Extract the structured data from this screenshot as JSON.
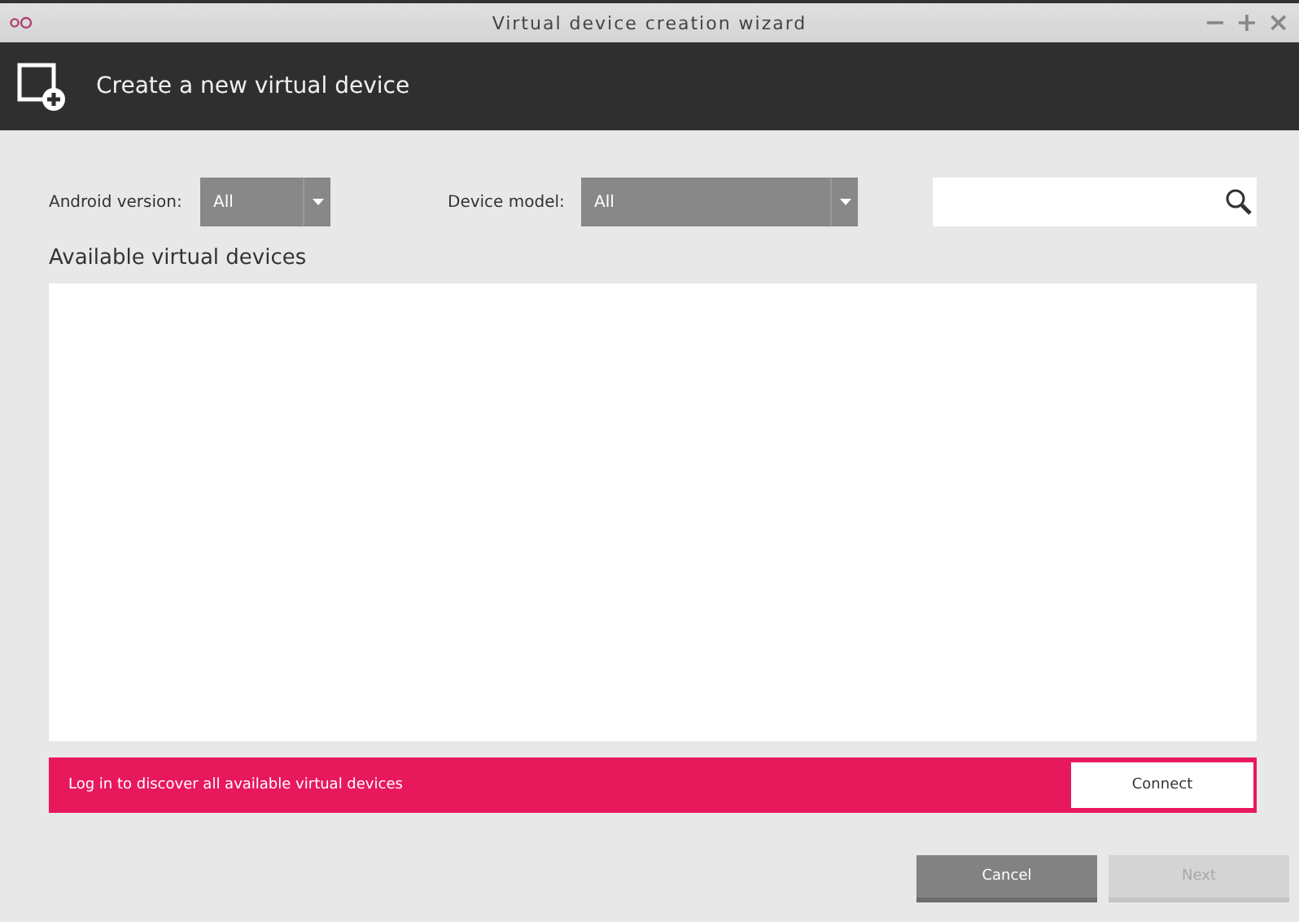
{
  "window": {
    "title": "Virtual device creation wizard",
    "controls": [
      "−",
      "+",
      "×"
    ]
  },
  "header": {
    "title": "Create a new virtual device"
  },
  "filters": [
    {
      "label": "Android version:",
      "value": "All"
    },
    {
      "label": "Device model:",
      "value": "All"
    }
  ],
  "list": {
    "title": "Available virtual devices"
  },
  "banner": {
    "message": "Log in to discover all available virtual devices",
    "button": "Connect"
  },
  "buttons": [
    {
      "label": "Cancel",
      "disabled": false
    },
    {
      "label": "Next",
      "disabled": true
    }
  ]
}
